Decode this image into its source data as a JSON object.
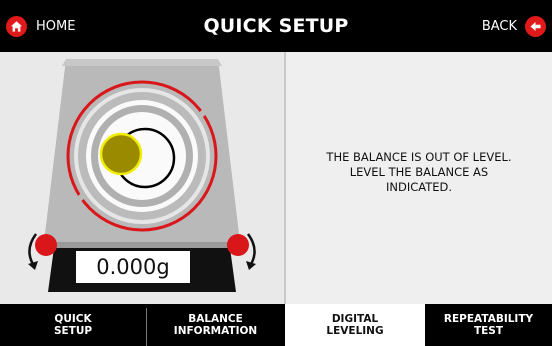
{
  "header": {
    "home_label": "HOME",
    "title": "QUICK SETUP",
    "back_label": "BACK",
    "icons": {
      "home": "home-icon",
      "back": "back-arrow-icon"
    }
  },
  "scale": {
    "weight": "0.000g",
    "bubble_status": "out of level",
    "icons": {
      "left_foot_rotate": "rotate-counterclockwise-arrow-icon",
      "right_foot_rotate": "rotate-clockwise-arrow-icon"
    }
  },
  "message": {
    "lines": [
      "THE BALANCE IS OUT OF LEVEL.",
      "LEVEL THE BALANCE AS",
      "INDICATED."
    ]
  },
  "tabs": [
    {
      "line1": "QUICK",
      "line2": "SETUP",
      "active": false
    },
    {
      "line1": "BALANCE",
      "line2": "INFORMATION",
      "active": false
    },
    {
      "line1": "DIGITAL",
      "line2": "LEVELING",
      "active": true
    },
    {
      "line1": "REPEATABILITY",
      "line2": "TEST",
      "active": false
    }
  ],
  "colors": {
    "accent_red": "#e01a1a",
    "bubble": "#9a8a00",
    "bubble_outline": "#f2ec00",
    "header_bg": "#000000"
  }
}
